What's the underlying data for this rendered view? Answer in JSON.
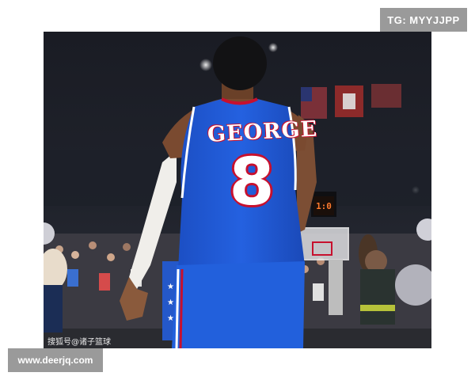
{
  "overlays": {
    "tag": "TG: MYYJJPP",
    "site": "www.deerjq.com",
    "watermark": "搜狐号@诸子篮球"
  },
  "jersey": {
    "name": "GEORGE",
    "number": "8"
  },
  "scoreboard": {
    "clock": "1:0"
  },
  "colors": {
    "jersey_blue": "#1e5bd8",
    "jersey_red": "#c7102e",
    "overlay_gray": "#9a9a9a",
    "arena_dark": "#15161c"
  }
}
